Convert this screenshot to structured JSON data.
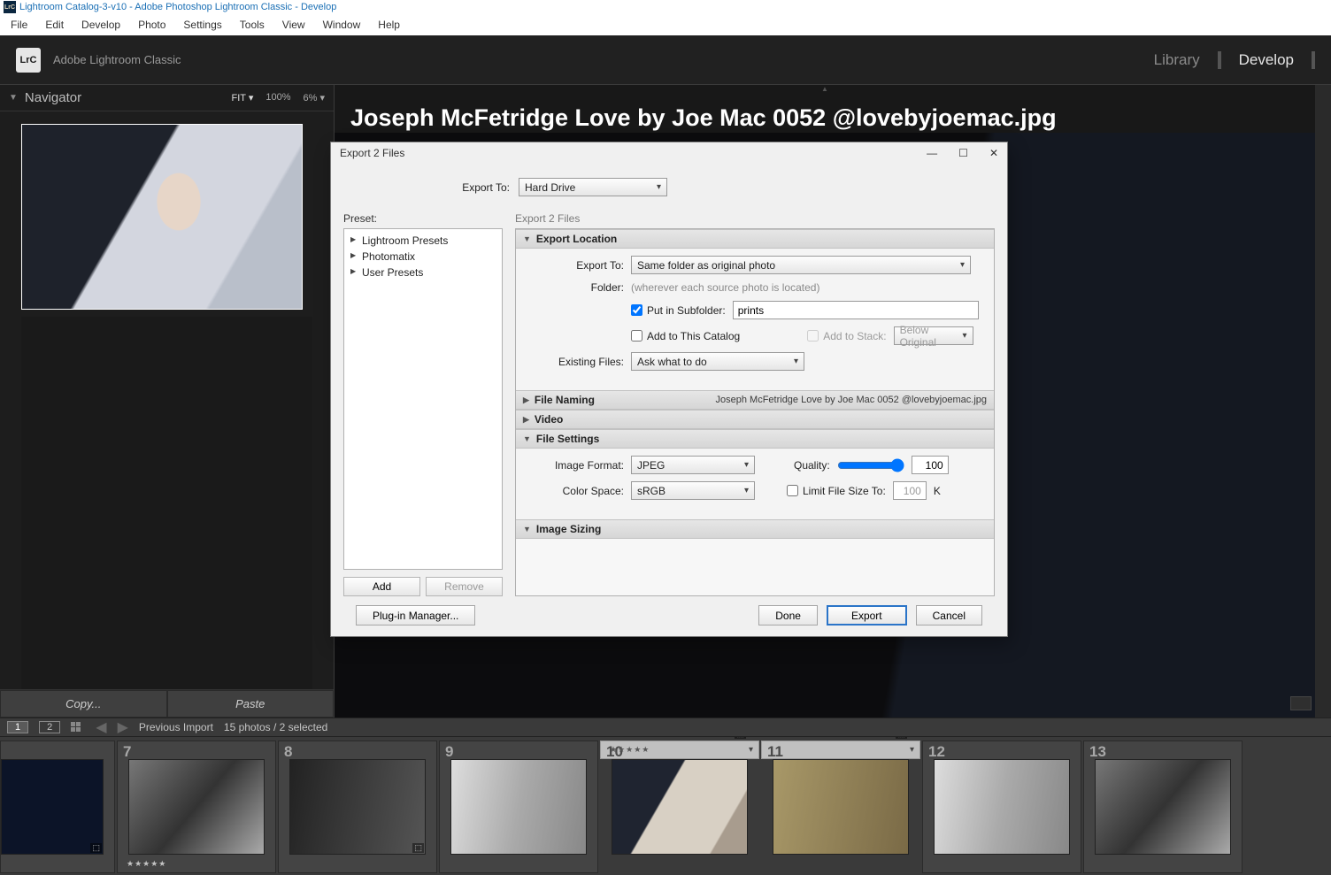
{
  "window": {
    "title": "Lightroom Catalog-3-v10 - Adobe Photoshop Lightroom Classic - Develop"
  },
  "menubar": [
    "File",
    "Edit",
    "Develop",
    "Photo",
    "Settings",
    "Tools",
    "View",
    "Window",
    "Help"
  ],
  "brand": {
    "logo": "LrC",
    "name": "Adobe Lightroom Classic",
    "modules": {
      "library": "Library",
      "develop": "Develop"
    }
  },
  "navigator": {
    "title": "Navigator",
    "zoom": {
      "fit": "FIT  ▾",
      "p100": "100%",
      "p6": "6%  ▾"
    }
  },
  "left_buttons": {
    "copy": "Copy...",
    "paste": "Paste"
  },
  "filmstrip_meta": {
    "one": "1",
    "two": "2",
    "prev_import": "Previous Import",
    "count": "15 photos / 2 selected"
  },
  "thumbs": [
    {
      "n": "",
      "stars": ""
    },
    {
      "n": "7",
      "stars": "★★★★★"
    },
    {
      "n": "8",
      "stars": ""
    },
    {
      "n": "9",
      "stars": ""
    },
    {
      "n": "10",
      "stars": "★★★★★"
    },
    {
      "n": "11",
      "stars": ""
    },
    {
      "n": "12",
      "stars": ""
    },
    {
      "n": "13",
      "stars": ""
    }
  ],
  "doc_title": "Joseph McFetridge Love by Joe Mac 0052 @lovebyjoemac.jpg",
  "dialog": {
    "title": "Export 2 Files",
    "export_to_label": "Export To:",
    "export_to_value": "Hard Drive",
    "preset_label": "Preset:",
    "presets": [
      "Lightroom Presets",
      "Photomatix",
      "User Presets"
    ],
    "preset_buttons": {
      "add": "Add",
      "remove": "Remove"
    },
    "right_label": "Export 2 Files",
    "sections": {
      "export_location": {
        "title": "Export Location",
        "export_to_label": "Export To:",
        "export_to_value": "Same folder as original photo",
        "folder_label": "Folder:",
        "folder_hint": "(wherever each source photo is located)",
        "subfolder_label": "Put in Subfolder:",
        "subfolder_value": "prints",
        "add_catalog": "Add to This Catalog",
        "add_stack": "Add to Stack:",
        "stack_value": "Below Original",
        "existing_label": "Existing Files:",
        "existing_value": "Ask what to do"
      },
      "file_naming": {
        "title": "File Naming",
        "hint": "Joseph McFetridge Love by Joe Mac 0052 @lovebyjoemac.jpg"
      },
      "video": {
        "title": "Video"
      },
      "file_settings": {
        "title": "File Settings",
        "format_label": "Image Format:",
        "format_value": "JPEG",
        "quality_label": "Quality:",
        "quality_value": "100",
        "colorspace_label": "Color Space:",
        "colorspace_value": "sRGB",
        "limit_label": "Limit File Size To:",
        "limit_value": "100",
        "limit_unit": "K"
      },
      "image_sizing": {
        "title": "Image Sizing"
      }
    },
    "footer": {
      "plugin": "Plug-in Manager...",
      "done": "Done",
      "export": "Export",
      "cancel": "Cancel"
    }
  }
}
